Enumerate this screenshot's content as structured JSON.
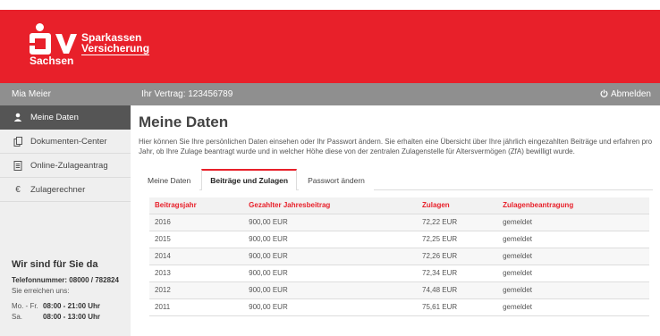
{
  "brand": {
    "logo_line1": "Sparkassen",
    "logo_line2": "Versicherung",
    "logo_sub": "Sachsen",
    "color": "#e8202a"
  },
  "userbar": {
    "user": "Mia Meier",
    "contract": "Ihr Vertrag: 123456789",
    "logout": "Abmelden",
    "logout_icon": "power-icon"
  },
  "sidebar": {
    "items": [
      {
        "label": "Meine Daten",
        "icon": "user-icon",
        "active": true
      },
      {
        "label": "Dokumenten-Center",
        "icon": "documents-icon",
        "active": false
      },
      {
        "label": "Online-Zulageantrag",
        "icon": "form-icon",
        "active": false
      },
      {
        "label": "Zulagerechner",
        "icon": "euro-icon",
        "active": false
      }
    ],
    "contact": {
      "title": "Wir sind für Sie da",
      "phone": "Telefonnummer: 08000 / 782824",
      "reach": "Sie erreichen uns:",
      "hours": [
        {
          "days": "Mo. - Fr.",
          "time": "08:00 - 21:00 Uhr"
        },
        {
          "days": "Sa.",
          "time": "08:00 - 13:00 Uhr"
        }
      ]
    }
  },
  "main": {
    "title": "Meine Daten",
    "intro": "Hier können Sie Ihre persönlichen Daten einsehen oder Ihr Passwort ändern. Sie erhalten eine Übersicht über Ihre jährlich eingezahlten Beiträge und erfahren pro Jahr, ob Ihre Zulage beantragt wurde und in welcher Höhe diese von der zentralen Zulagenstelle für Altersvermögen (ZfA) bewilligt wurde.",
    "tabs": [
      {
        "label": "Meine Daten",
        "active": false
      },
      {
        "label": "Beiträge und Zulagen",
        "active": true
      },
      {
        "label": "Passwort ändern",
        "active": false
      }
    ],
    "table": {
      "headers": [
        "Beitragsjahr",
        "Gezahlter Jahresbeitrag",
        "Zulagen",
        "Zulagenbeantragung"
      ],
      "rows": [
        [
          "2016",
          "900,00 EUR",
          "72,22 EUR",
          "gemeldet"
        ],
        [
          "2015",
          "900,00 EUR",
          "72,25 EUR",
          "gemeldet"
        ],
        [
          "2014",
          "900,00 EUR",
          "72,26 EUR",
          "gemeldet"
        ],
        [
          "2013",
          "900,00 EUR",
          "72,34 EUR",
          "gemeldet"
        ],
        [
          "2012",
          "900,00 EUR",
          "74,48 EUR",
          "gemeldet"
        ],
        [
          "2011",
          "900,00 EUR",
          "75,61 EUR",
          "gemeldet"
        ]
      ]
    }
  }
}
